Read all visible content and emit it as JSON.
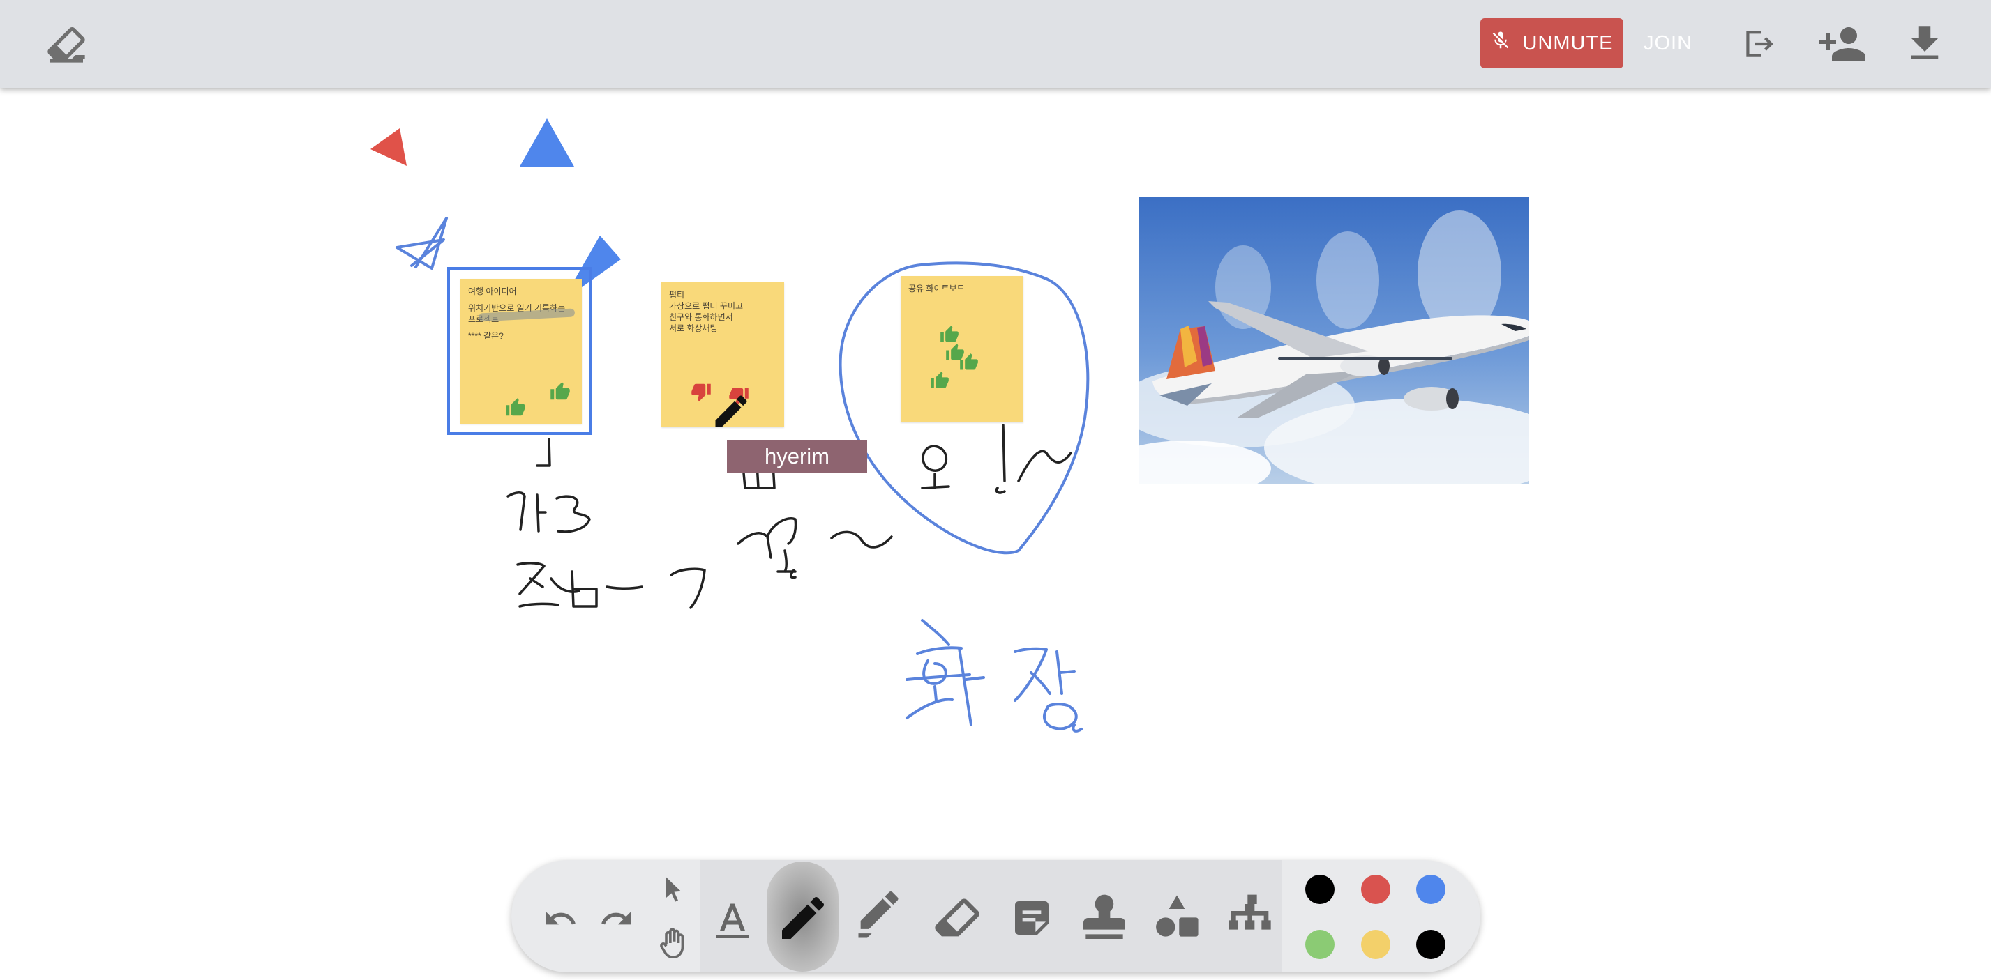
{
  "header": {
    "unmute_label": "UNMUTE",
    "join_label": "JOIN",
    "icons": [
      "clear-board-icon",
      "mic-off-icon",
      "leave-icon",
      "invite-user-icon",
      "download-icon"
    ]
  },
  "canvas": {
    "stickies": [
      {
        "lines": [
          "여행 아이디어",
          "",
          "위치기반으로 일기 기록하는",
          "프로젝트",
          "",
          "**** 같은?"
        ],
        "reactions": [
          "thumb-up-icon",
          "thumb-up-icon"
        ]
      },
      {
        "lines": [
          "펍티",
          "가상으로 펍터 꾸미고",
          "친구와 통화하면서",
          "서로 화상채팅"
        ],
        "reactions": [
          "thumb-down-icon",
          "thumb-down-icon"
        ]
      },
      {
        "lines": [
          "공유 화이트보드"
        ],
        "reactions": [
          "thumb-up-icon",
          "thumb-up-icon",
          "thumb-up-icon",
          "thumb-up-icon"
        ]
      }
    ],
    "cursor_user": "hyerim",
    "image_label": "airplane-photo"
  },
  "toolbar": {
    "tools": [
      "undo-icon",
      "redo-icon",
      "select-icon",
      "pan-icon",
      "text-icon",
      "pen-icon",
      "highlighter-icon",
      "eraser-icon",
      "sticky-note-icon",
      "stamp-icon",
      "shapes-icon",
      "diagram-icon"
    ],
    "active_tool": "pen",
    "colors": [
      "#000000",
      "#d9534f",
      "#4f86ec",
      "#8bcb74",
      "#f3d06a",
      "#000000"
    ]
  }
}
